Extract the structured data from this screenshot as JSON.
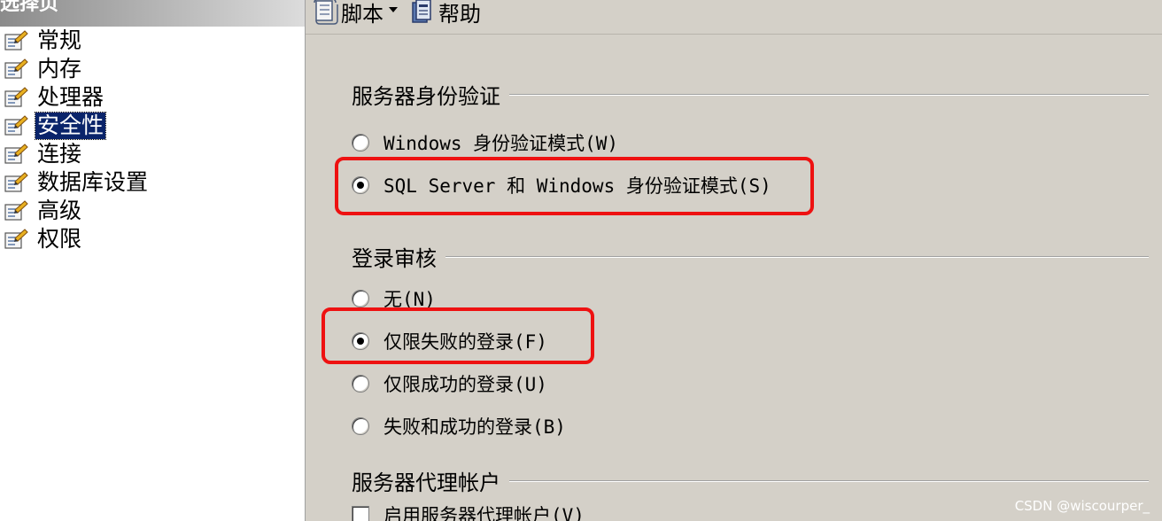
{
  "left_pane": {
    "header": "选择页",
    "items": [
      {
        "label": "常规",
        "selected": false
      },
      {
        "label": "内存",
        "selected": false
      },
      {
        "label": "处理器",
        "selected": false
      },
      {
        "label": "安全性",
        "selected": true
      },
      {
        "label": "连接",
        "selected": false
      },
      {
        "label": "数据库设置",
        "selected": false
      },
      {
        "label": "高级",
        "selected": false
      },
      {
        "label": "权限",
        "selected": false
      }
    ]
  },
  "toolbar": {
    "script_label": "脚本",
    "help_label": "帮助"
  },
  "auth": {
    "title": "服务器身份验证",
    "windows_mode": "Windows 身份验证模式(W)",
    "mixed_mode": "SQL Server 和 Windows 身份验证模式(S)",
    "selected": "mixed_mode"
  },
  "login_audit": {
    "title": "登录审核",
    "none": "无(N)",
    "failed_only": "仅限失败的登录(F)",
    "success_only": "仅限成功的登录(U)",
    "both": "失败和成功的登录(B)",
    "selected": "failed_only"
  },
  "proxy": {
    "title": "服务器代理帐户",
    "enable_label": "启用服务器代理帐户(V)",
    "enabled": false
  },
  "colors": {
    "selection_bg": "#0a246a",
    "highlight_box": "#ee1111",
    "panel_bg": "#d4d0c8"
  },
  "watermark": "CSDN @wiscourper_"
}
